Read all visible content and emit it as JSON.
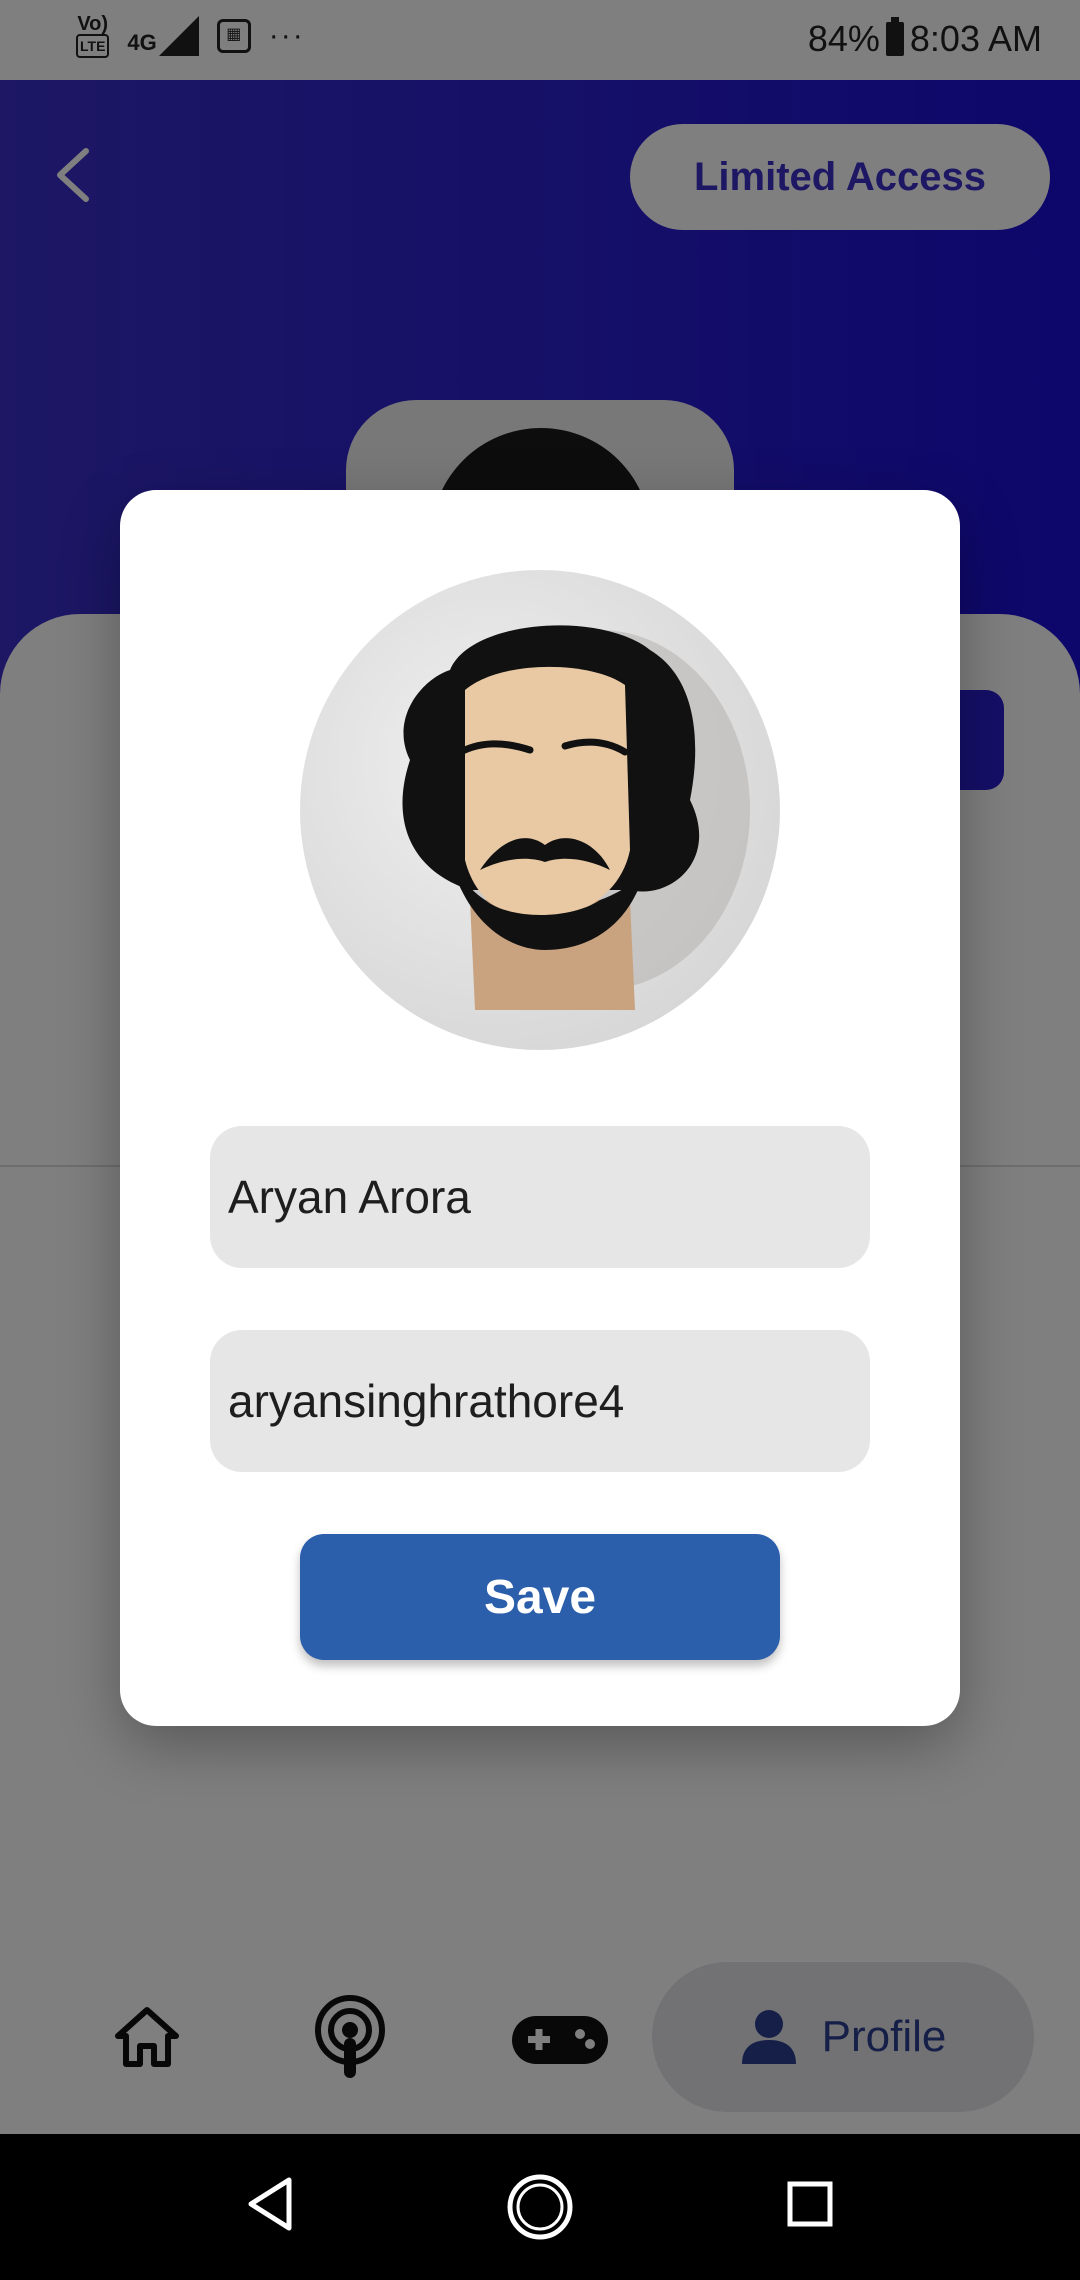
{
  "status_bar": {
    "volte_top": "Vo)",
    "volte_bottom": "LTE",
    "network": "4G",
    "more": "···",
    "battery": "84%",
    "time": "8:03 AM"
  },
  "header": {
    "limited_access_label": "Limited Access"
  },
  "dialog": {
    "name_value": "Aryan Arora",
    "username_value": "aryansinghrathore4",
    "save_label": "Save"
  },
  "bottom_nav": {
    "items": [
      {
        "icon": "home-icon"
      },
      {
        "icon": "podcast-icon"
      },
      {
        "icon": "gamepad-icon"
      },
      {
        "icon": "person-icon",
        "label": "Profile"
      }
    ],
    "active_color": "#2b3f8f"
  },
  "colors": {
    "header_gradient_start": "#3a2fc8",
    "header_gradient_end": "#1a0ed8",
    "save_button": "#2b5fab",
    "field_bg": "#e6e6e6"
  }
}
